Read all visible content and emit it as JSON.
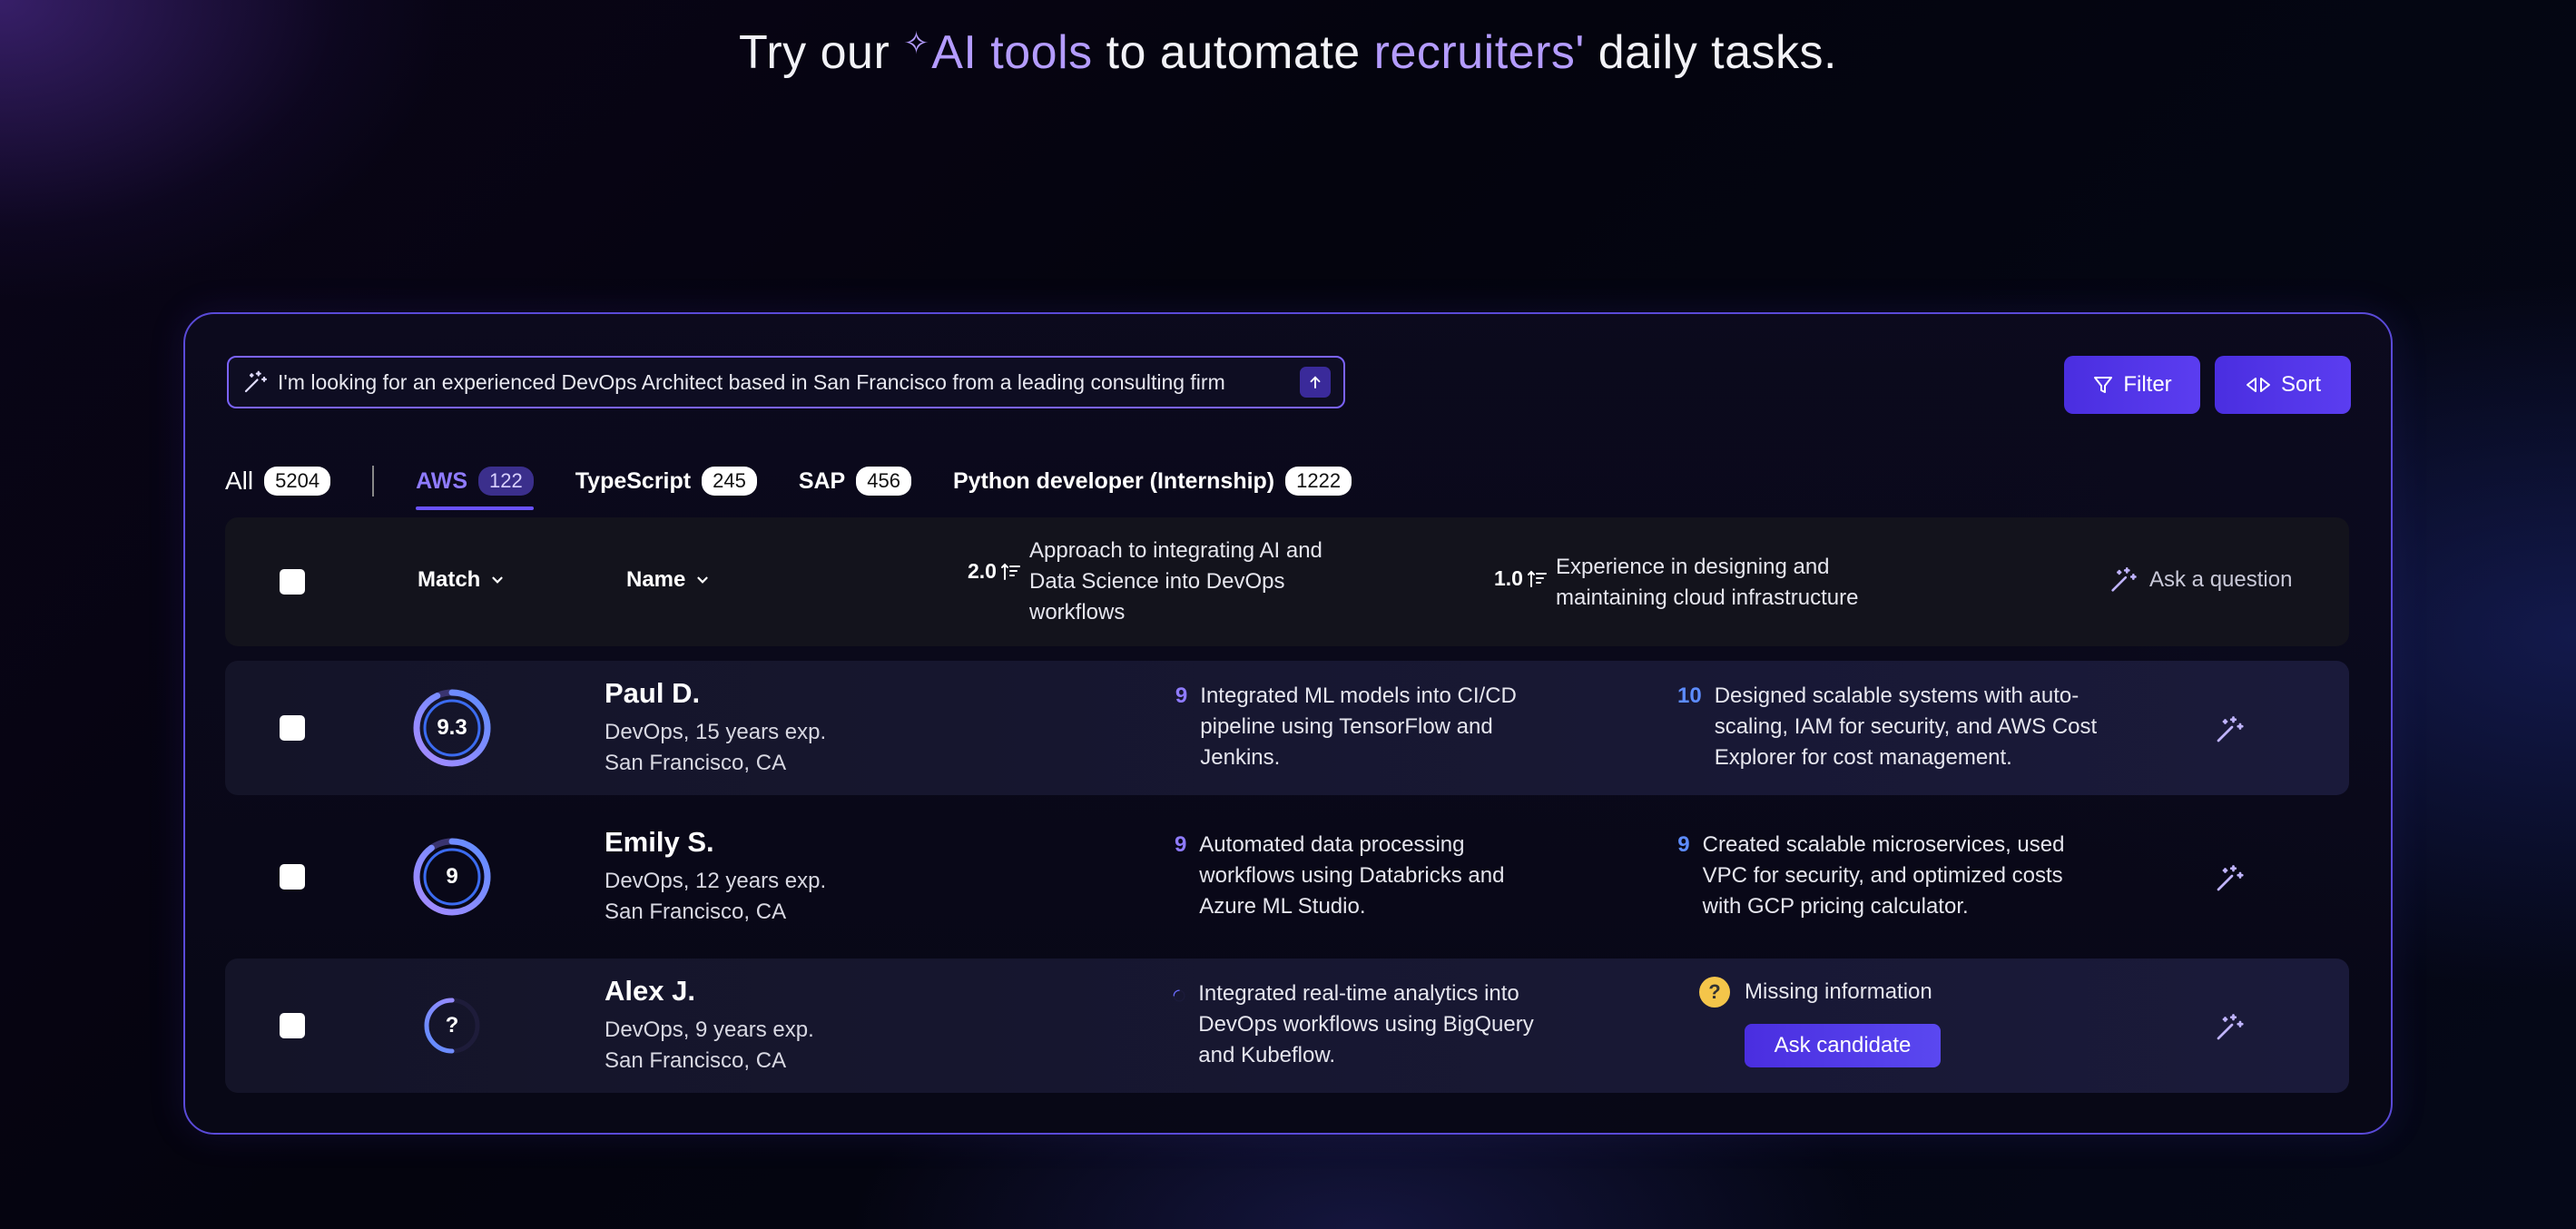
{
  "headline": {
    "prefix": "Try our ",
    "sparkle": "✧",
    "accent1": "AI tools",
    "middle": " to automate ",
    "accent2": "recruiters'",
    "suffix": " daily tasks."
  },
  "colors": {
    "accent": "#6a52ff",
    "button": "#4a2ee0",
    "score_purple": "#8f7bff",
    "score_blue": "#5d8cff",
    "warning": "#f4c54a"
  },
  "search": {
    "query": "I'm looking for an experienced DevOps Architect based in San Francisco from a leading consulting firm",
    "submit_icon": "arrow-up-icon"
  },
  "toolbar": {
    "filter_label": "Filter",
    "sort_label": "Sort"
  },
  "tabs": [
    {
      "label": "All",
      "count": "5204",
      "active": false
    },
    {
      "label": "AWS",
      "count": "122",
      "active": true
    },
    {
      "label": "TypeScript",
      "count": "245",
      "active": false
    },
    {
      "label": "SAP",
      "count": "456",
      "active": false
    },
    {
      "label": "Python developer (Internship)",
      "count": "1222",
      "active": false
    }
  ],
  "table": {
    "columns": {
      "match": "Match",
      "name": "Name",
      "q1_weight": "2.0",
      "q1": "Approach to integrating AI and Data Science into DevOps workflows",
      "q2_weight": "1.0",
      "q2": "Experience in designing and maintaining cloud infrastructure",
      "ask": "Ask a question"
    },
    "rows": [
      {
        "match": "9.3",
        "match_fraction": 0.93,
        "name": "Paul D.",
        "role": "DevOps, 15 years exp.",
        "location": "San Francisco, CA",
        "q1_score": "9",
        "q1_answer": "Integrated ML models into CI/CD pipeline using TensorFlow and Jenkins.",
        "q2_score": "10",
        "q2_answer": "Designed scalable systems with auto-scaling, IAM for security, and AWS Cost Explorer for cost management."
      },
      {
        "match": "9",
        "match_fraction": 0.9,
        "name": "Emily S.",
        "role": "DevOps, 12 years exp.",
        "location": "San Francisco, CA",
        "q1_score": "9",
        "q1_answer": "Automated data processing workflows using Databricks and Azure ML Studio.",
        "q2_score": "9",
        "q2_answer": "Created scalable microservices, used VPC for security, and optimized costs with GCP pricing calculator."
      },
      {
        "match": "?",
        "match_fraction": 0.5,
        "name": "Alex J.",
        "role": "DevOps, 9 years exp.",
        "location": "San Francisco, CA",
        "q1_answer": "Integrated real-time analytics into DevOps workflows using BigQuery and Kubeflow.",
        "q2_badge": "?",
        "q2_missing": "Missing information",
        "q2_button": "Ask candidate"
      }
    ]
  }
}
